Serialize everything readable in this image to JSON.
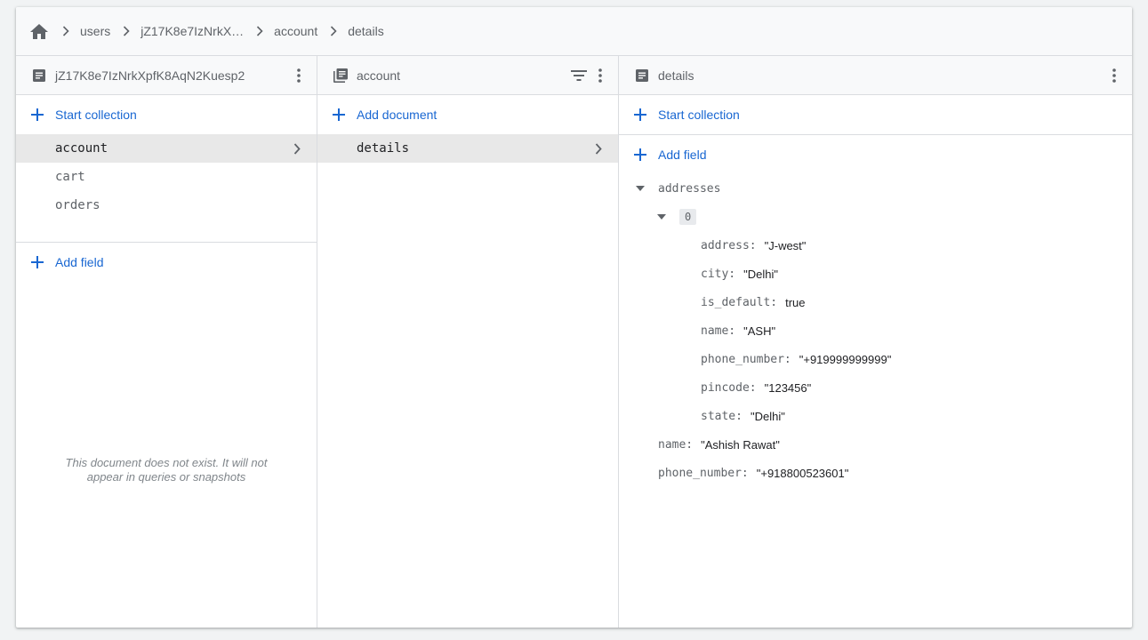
{
  "breadcrumb": {
    "home_icon": "home-icon",
    "items": [
      "users",
      "jZ17K8e7IzNrkXpfK8AqN2Kuesp2",
      "account",
      "details"
    ],
    "truncated_doc": "jZ17K8e7IzNrkX…"
  },
  "panel1": {
    "icon": "document-icon",
    "title": "jZ17K8e7IzNrkXpfK8AqN2Kuesp2",
    "start_collection": "Start collection",
    "collections": [
      "account",
      "cart",
      "orders"
    ],
    "add_field": "Add field",
    "empty_note": "This document does not exist. It will not appear in queries or snapshots"
  },
  "panel2": {
    "icon": "collection-icon",
    "title": "account",
    "add_document": "Add document",
    "documents": [
      "details"
    ]
  },
  "panel3": {
    "icon": "document-icon",
    "title": "details",
    "start_collection": "Start collection",
    "add_field": "Add field",
    "fields": {
      "addresses_key": "addresses",
      "index0": "0",
      "address_key": "address:",
      "address_val": "\"J-west\"",
      "city_key": "city:",
      "city_val": "\"Delhi\"",
      "is_default_key": "is_default:",
      "is_default_val": "true",
      "name_key": "name:",
      "name_val": "\"ASH\"",
      "phone_key": "phone_number:",
      "phone_val": "\"+919999999999\"",
      "pincode_key": "pincode:",
      "pincode_val": "\"123456\"",
      "state_key": "state:",
      "state_val": "\"Delhi\"",
      "top_name_key": "name:",
      "top_name_val": "\"Ashish Rawat\"",
      "top_phone_key": "phone_number:",
      "top_phone_val": "\"+918800523601\""
    }
  },
  "colors": {
    "accent": "#1967d2",
    "muted": "#5f6368",
    "selected_bg": "#e8e8e8",
    "border": "#dadce0"
  }
}
